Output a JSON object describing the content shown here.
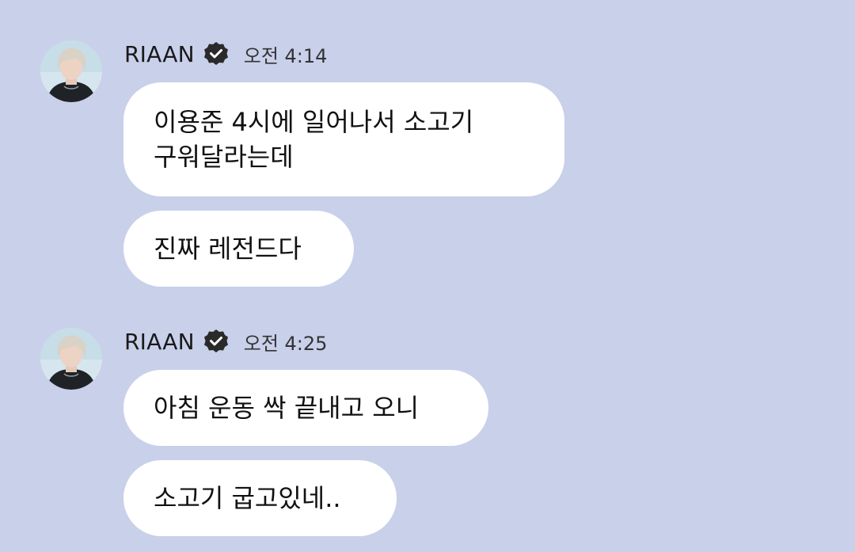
{
  "chat": {
    "background_color": "#c9d0ea",
    "bubble_color": "#ffffff",
    "groups": [
      {
        "sender": "RIAAN",
        "verified_icon": "verified-badge-icon",
        "time": "오전 4:14",
        "messages": [
          "이용준 4시에 일어나서 소고기\n구워달라는데",
          "진짜 레전드다"
        ]
      },
      {
        "sender": "RIAAN",
        "verified_icon": "verified-badge-icon",
        "time": "오전 4:25",
        "messages": [
          "아침 운동 싹 끝내고 오니",
          "소고기 굽고있네.."
        ]
      }
    ]
  }
}
